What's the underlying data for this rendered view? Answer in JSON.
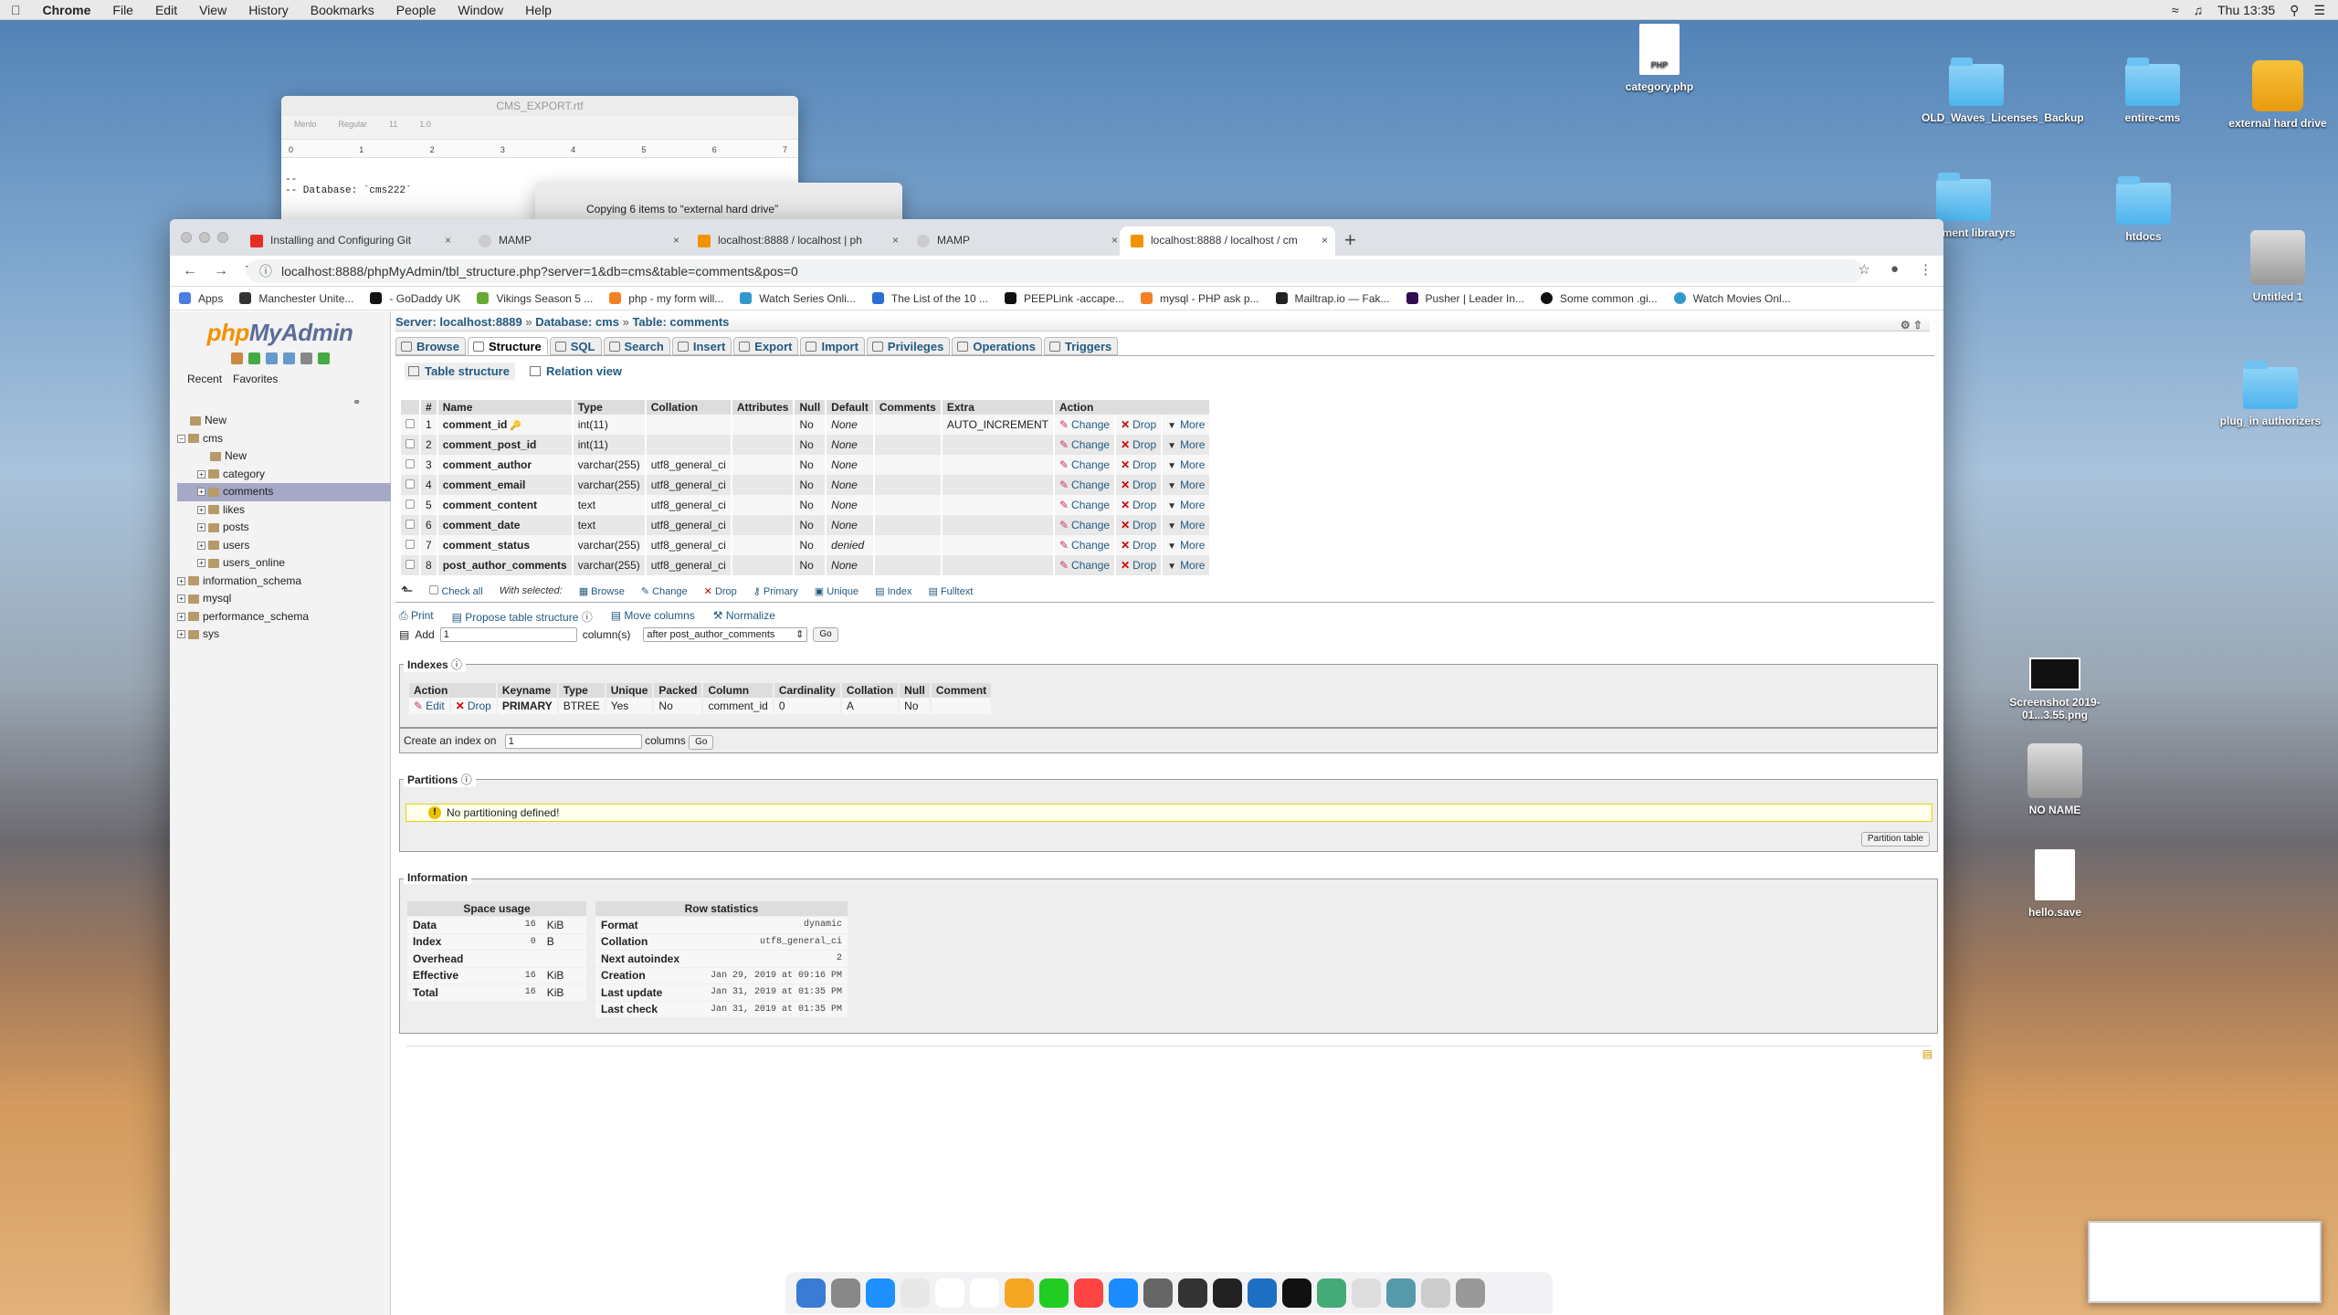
{
  "menubar": {
    "app": "Chrome",
    "items": [
      "File",
      "Edit",
      "View",
      "History",
      "Bookmarks",
      "People",
      "Window",
      "Help"
    ],
    "clock": "Thu 13:35"
  },
  "desktop": {
    "icons": [
      {
        "label": "category.php",
        "kind": "doc",
        "doc_text": "PHP"
      },
      {
        "label": "OLD_Waves_Licenses_Backup",
        "kind": "folder"
      },
      {
        "label": "entire-cms",
        "kind": "folder"
      },
      {
        "label": "external hard drive",
        "kind": "drive"
      },
      {
        "label": "instrument libraryrs",
        "kind": "folder"
      },
      {
        "label": "htdocs",
        "kind": "folder"
      },
      {
        "label": "Untitled 1",
        "kind": "disk"
      },
      {
        "label": "plug_in authorizers",
        "kind": "folder"
      },
      {
        "label": "Screenshot 2019-01...3.55.png",
        "kind": "shot"
      },
      {
        "label": "NO NAME",
        "kind": "disk"
      },
      {
        "label": "hello.save",
        "kind": "doc",
        "doc_text": ""
      }
    ]
  },
  "rtf": {
    "title": "CMS_EXPORT.rtf",
    "font": "Menlo",
    "style": "Regular",
    "size": "11",
    "spacing": "1.0",
    "ruler": [
      "0",
      "1",
      "2",
      "3",
      "4",
      "5",
      "6",
      "7"
    ],
    "body": "--\n-- Database: `cms222`"
  },
  "copy_dialog": {
    "text": "Copying 6 items to “external hard drive”"
  },
  "chrome": {
    "tabs": [
      {
        "title": "Installing and Configuring Git",
        "color": "#e52d27"
      },
      {
        "title": "MAMP",
        "color": "#555"
      },
      {
        "title": "localhost:8888 / localhost | ph",
        "color": "#f29200"
      },
      {
        "title": "MAMP",
        "color": "#555"
      },
      {
        "title": "localhost:8888 / localhost / cm",
        "color": "#f29200"
      }
    ],
    "url": "localhost:8888/phpMyAdmin/tbl_structure.php?server=1&db=cms&table=comments&pos=0",
    "bookmarks": [
      {
        "label": "Apps",
        "color": "#4a7de0"
      },
      {
        "label": "Manchester Unite...",
        "color": "#333"
      },
      {
        "label": "- GoDaddy UK",
        "color": "#111"
      },
      {
        "label": "Vikings Season 5 ...",
        "color": "#6a3"
      },
      {
        "label": "php - my form will...",
        "color": "#f48024"
      },
      {
        "label": "Watch Series Onli...",
        "color": "#39c"
      },
      {
        "label": "The List of the 10 ...",
        "color": "#2a6fd6"
      },
      {
        "label": "PEEPLink -accape...",
        "color": "#111"
      },
      {
        "label": "mysql - PHP ask p...",
        "color": "#f48024"
      },
      {
        "label": "Mailtrap.io — Fak...",
        "color": "#222"
      },
      {
        "label": "Pusher | Leader In...",
        "color": "#300d4f"
      },
      {
        "label": "Some common .gi...",
        "color": "#111"
      },
      {
        "label": "Watch Movies Onl...",
        "color": "#39c"
      }
    ]
  },
  "pma": {
    "nav": {
      "logo_php": "php",
      "logo_rest": "MyAdmin",
      "tabs": [
        "Recent",
        "Favorites"
      ],
      "tree": [
        {
          "label": "New",
          "level": 0,
          "sel": false,
          "exp": ""
        },
        {
          "label": "cms",
          "level": 0,
          "sel": false,
          "exp": "−"
        },
        {
          "label": "New",
          "level": 1,
          "sel": false,
          "exp": ""
        },
        {
          "label": "category",
          "level": 1,
          "sel": false,
          "exp": "+"
        },
        {
          "label": "comments",
          "level": 1,
          "sel": true,
          "exp": "+"
        },
        {
          "label": "likes",
          "level": 1,
          "sel": false,
          "exp": "+"
        },
        {
          "label": "posts",
          "level": 1,
          "sel": false,
          "exp": "+"
        },
        {
          "label": "users",
          "level": 1,
          "sel": false,
          "exp": "+"
        },
        {
          "label": "users_online",
          "level": 1,
          "sel": false,
          "exp": "+"
        },
        {
          "label": "information_schema",
          "level": 0,
          "sel": false,
          "exp": "+"
        },
        {
          "label": "mysql",
          "level": 0,
          "sel": false,
          "exp": "+"
        },
        {
          "label": "performance_schema",
          "level": 0,
          "sel": false,
          "exp": "+"
        },
        {
          "label": "sys",
          "level": 0,
          "sel": false,
          "exp": "+"
        }
      ]
    },
    "breadcrumb": {
      "server": "Server: localhost:8889",
      "database": "Database: cms",
      "table": "Table: comments"
    },
    "menu": [
      "Browse",
      "Structure",
      "SQL",
      "Search",
      "Insert",
      "Export",
      "Import",
      "Privileges",
      "Operations",
      "Triggers"
    ],
    "active_menu": "Structure",
    "submenu": [
      "Table structure",
      "Relation view"
    ],
    "structure": {
      "headers": [
        "",
        "#",
        "Name",
        "Type",
        "Collation",
        "Attributes",
        "Null",
        "Default",
        "Comments",
        "Extra",
        "Action"
      ],
      "rows": [
        {
          "num": "1",
          "name": "comment_id",
          "type": "int(11)",
          "collation": "",
          "null": "No",
          "default": "None",
          "extra": "AUTO_INCREMENT"
        },
        {
          "num": "2",
          "name": "comment_post_id",
          "type": "int(11)",
          "collation": "",
          "null": "No",
          "default": "None",
          "extra": ""
        },
        {
          "num": "3",
          "name": "comment_author",
          "type": "varchar(255)",
          "collation": "utf8_general_ci",
          "null": "No",
          "default": "None",
          "extra": ""
        },
        {
          "num": "4",
          "name": "comment_email",
          "type": "varchar(255)",
          "collation": "utf8_general_ci",
          "null": "No",
          "default": "None",
          "extra": ""
        },
        {
          "num": "5",
          "name": "comment_content",
          "type": "text",
          "collation": "utf8_general_ci",
          "null": "No",
          "default": "None",
          "extra": ""
        },
        {
          "num": "6",
          "name": "comment_date",
          "type": "text",
          "collation": "utf8_general_ci",
          "null": "No",
          "default": "None",
          "extra": ""
        },
        {
          "num": "7",
          "name": "comment_status",
          "type": "varchar(255)",
          "collation": "utf8_general_ci",
          "null": "No",
          "default": "denied",
          "extra": ""
        },
        {
          "num": "8",
          "name": "post_author_comments",
          "type": "varchar(255)",
          "collation": "utf8_general_ci",
          "null": "No",
          "default": "None",
          "extra": ""
        }
      ],
      "actions": {
        "change": "Change",
        "drop": "Drop",
        "more": "More"
      }
    },
    "with_selected": {
      "check_all": "Check all",
      "label": "With selected:",
      "actions": [
        "Browse",
        "Change",
        "Drop",
        "Primary",
        "Unique",
        "Index",
        "Fulltext"
      ]
    },
    "tools": {
      "print": "Print",
      "propose": "Propose table structure",
      "move": "Move columns",
      "normalize": "Normalize"
    },
    "add": {
      "label": "Add",
      "value": "1",
      "suffix": "column(s)",
      "position": "after post_author_comments",
      "go": "Go"
    },
    "indexes": {
      "title": "Indexes",
      "headers": [
        "Action",
        "Keyname",
        "Type",
        "Unique",
        "Packed",
        "Column",
        "Cardinality",
        "Collation",
        "Null",
        "Comment"
      ],
      "row": {
        "edit": "Edit",
        "drop": "Drop",
        "keyname": "PRIMARY",
        "type": "BTREE",
        "unique": "Yes",
        "packed": "No",
        "column": "comment_id",
        "cardinality": "0",
        "collation": "A",
        "null": "No",
        "comment": ""
      },
      "create_label": "Create an index on",
      "create_value": "1",
      "create_suffix": "columns",
      "go": "Go"
    },
    "partitions": {
      "title": "Partitions",
      "message": "No partitioning defined!",
      "button": "Partition table"
    },
    "information": {
      "title": "Information",
      "space_title": "Space usage",
      "space": [
        {
          "k": "Data",
          "v": "16",
          "u": "KiB"
        },
        {
          "k": "Index",
          "v": "0",
          "u": "B"
        },
        {
          "k": "Overhead",
          "v": "",
          "u": ""
        },
        {
          "k": "Effective",
          "v": "16",
          "u": "KiB"
        },
        {
          "k": "Total",
          "v": "16",
          "u": "KiB"
        }
      ],
      "row_title": "Row statistics",
      "rows": [
        {
          "k": "Format",
          "v": "dynamic"
        },
        {
          "k": "Collation",
          "v": "utf8_general_ci"
        },
        {
          "k": "Next autoindex",
          "v": "2"
        },
        {
          "k": "Creation",
          "v": "Jan 29, 2019 at 09:16 PM"
        },
        {
          "k": "Last update",
          "v": "Jan 31, 2019 at 01:35 PM"
        },
        {
          "k": "Last check",
          "v": "Jan 31, 2019 at 01:35 PM"
        }
      ]
    }
  },
  "dock": {
    "colors": [
      "#3a7bd5",
      "#888",
      "#1e90ff",
      "#e8e8e8",
      "#fff",
      "#fff",
      "#f5a623",
      "#2c2",
      "#f44",
      "#1a8cff",
      "#666",
      "#333",
      "#222",
      "#1d6fc4",
      "#111",
      "#4a7",
      "#ddd",
      "#59a",
      "#ccc",
      "#999"
    ]
  }
}
